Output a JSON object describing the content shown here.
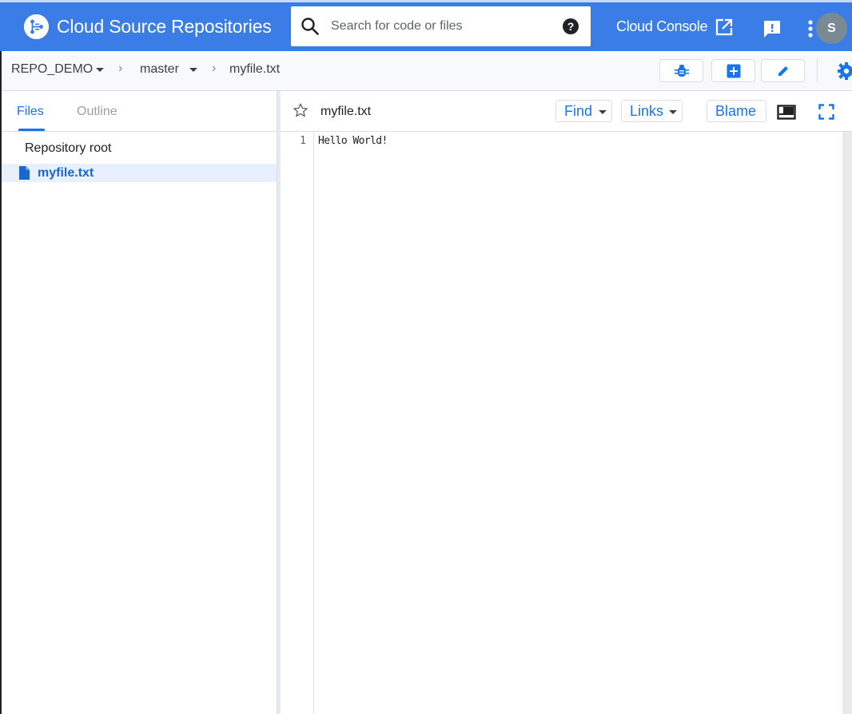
{
  "header": {
    "app_title": "Cloud Source Repositories",
    "search_placeholder": "Search for code or files",
    "help_glyph": "?",
    "console_link": "Cloud Console",
    "avatar_initial": "S",
    "bar_color": "#3b7de6"
  },
  "breadcrumb": {
    "repo": "REPO_DEMO",
    "branch": "master",
    "file": "myfile.txt",
    "separator_glyph": "›"
  },
  "toolbar": {
    "buttons": [
      "bug-icon",
      "add-box-icon",
      "edit-icon",
      "settings-icon"
    ]
  },
  "sidebar": {
    "tabs": [
      {
        "label": "Files",
        "active": true
      },
      {
        "label": "Outline",
        "active": false
      }
    ],
    "tree": {
      "root": "Repository root",
      "items": [
        {
          "name": "myfile.txt",
          "icon": "file-icon",
          "selected": true
        }
      ]
    }
  },
  "file": {
    "title": "myfile.txt",
    "find_label": "Find",
    "links_label": "Links",
    "blame_label": "Blame",
    "lines": [
      {
        "no": "1",
        "text": "Hello World!"
      }
    ]
  },
  "colors": {
    "accent": "#1a73e8",
    "selected_row": "#e8f0fe"
  }
}
